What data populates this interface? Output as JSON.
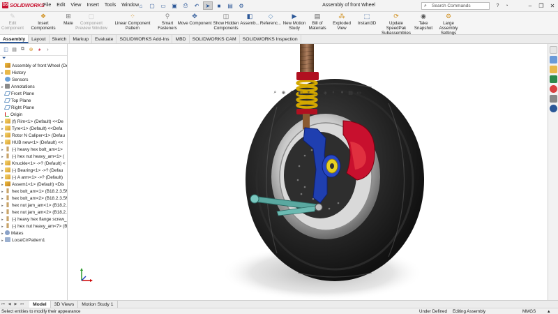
{
  "app": {
    "logo": "SOLIDWORKS",
    "doc_title": "Assembly of front Wheel"
  },
  "menu": [
    "File",
    "Edit",
    "View",
    "Insert",
    "Tools",
    "Window"
  ],
  "search": {
    "placeholder": "Search Commands"
  },
  "ribbon": [
    {
      "l1": "Edit",
      "l2": "Component",
      "state": "disabled",
      "icon": "edit-component-icon"
    },
    {
      "l1": "Insert Components",
      "l2": "",
      "state": "enabled",
      "icon": "insert-components-icon"
    },
    {
      "l1": "Mate",
      "l2": "",
      "state": "enabled",
      "icon": "mate-icon"
    },
    {
      "l1": "Component",
      "l2": "Preview Window",
      "state": "disabled",
      "icon": "preview-window-icon"
    },
    {
      "l1": "Linear Component Pattern",
      "l2": "",
      "state": "enabled",
      "icon": "pattern-icon"
    },
    {
      "l1": "Smart",
      "l2": "Fasteners",
      "state": "enabled",
      "icon": "fastener-icon"
    },
    {
      "l1": "Move Component",
      "l2": "",
      "state": "enabled",
      "icon": "move-icon"
    },
    {
      "l1": "Show Hidden",
      "l2": "Components",
      "state": "enabled",
      "icon": "show-hidden-icon"
    },
    {
      "l1": "Assemb...",
      "l2": "",
      "state": "enabled",
      "icon": "assembly-features-icon"
    },
    {
      "l1": "Referenc...",
      "l2": "",
      "state": "enabled",
      "icon": "reference-geometry-icon"
    },
    {
      "l1": "New Motion",
      "l2": "Study",
      "state": "enabled",
      "icon": "motion-study-icon"
    },
    {
      "l1": "Bill of",
      "l2": "Materials",
      "state": "enabled",
      "icon": "bom-icon"
    },
    {
      "l1": "Exploded View",
      "l2": "",
      "state": "enabled",
      "icon": "exploded-view-icon"
    },
    {
      "l1": "Instant3D",
      "l2": "",
      "state": "enabled",
      "icon": "instant3d-icon"
    },
    {
      "l1": "Update SpeedPak",
      "l2": "Subassemblies",
      "state": "enabled",
      "icon": "speedpak-icon"
    },
    {
      "l1": "Take",
      "l2": "Snapshot",
      "state": "enabled",
      "icon": "snapshot-icon"
    },
    {
      "l1": "Large Assembly",
      "l2": "Settings",
      "state": "enabled",
      "icon": "large-assembly-icon"
    }
  ],
  "tabs": [
    "Assembly",
    "Layout",
    "Sketch",
    "Markup",
    "Evaluate",
    "SOLIDWORKS Add-Ins",
    "MBD",
    "SOLIDWORKS CAM",
    "SOLIDWORKS Inspection"
  ],
  "tree": [
    {
      "label": "Assembly of front Wheel (Defa",
      "icon": "asm",
      "arrow": ""
    },
    {
      "label": "History",
      "icon": "folder",
      "arrow": "▸"
    },
    {
      "label": "Sensors",
      "icon": "sensor",
      "arrow": ""
    },
    {
      "label": "Annotations",
      "icon": "annot",
      "arrow": "▸"
    },
    {
      "label": "Front Plane",
      "icon": "plane",
      "arrow": ""
    },
    {
      "label": "Top Plane",
      "icon": "plane",
      "arrow": ""
    },
    {
      "label": "Right Plane",
      "icon": "plane",
      "arrow": ""
    },
    {
      "label": "Origin",
      "icon": "origin",
      "arrow": ""
    },
    {
      "label": "(f) Rim<1> (Default) <<De",
      "icon": "part",
      "arrow": "▸"
    },
    {
      "label": "Tyre<1> (Default) <<Defa",
      "icon": "part",
      "arrow": "▸"
    },
    {
      "label": "Rotor N Caliper<1> (Defau",
      "icon": "part",
      "arrow": "▸"
    },
    {
      "label": "HUB new<1> (Default) <<",
      "icon": "part",
      "arrow": "▸"
    },
    {
      "label": "(-) heavy hex bolt_am<1>",
      "icon": "bolt",
      "arrow": "▸"
    },
    {
      "label": "(-) hex nut heavy_am<1> (",
      "icon": "bolt",
      "arrow": "▸"
    },
    {
      "label": "Knuckle<1> ->? (Default) <",
      "icon": "part",
      "arrow": "▸"
    },
    {
      "label": "(-) Bearing<1> ->? (Defau",
      "icon": "part",
      "arrow": "▸"
    },
    {
      "label": "(-) A arm<1> ->? (Default)",
      "icon": "part",
      "arrow": "▸"
    },
    {
      "label": "Assem1<1> (Default) <Dis",
      "icon": "asm",
      "arrow": "▸"
    },
    {
      "label": "hex bolt_am<1> (B18.2.3.5M",
      "icon": "bolt",
      "arrow": "▸"
    },
    {
      "label": "hex bolt_am<2> (B18.2.3.5M",
      "icon": "bolt",
      "arrow": "▸"
    },
    {
      "label": "hex nut jam_am<1> (B18.2.",
      "icon": "bolt",
      "arrow": "▸"
    },
    {
      "label": "hex nut jam_am<2> (B18.2.",
      "icon": "bolt",
      "arrow": "▸"
    },
    {
      "label": "(-) heavy hex flange screw_",
      "icon": "bolt",
      "arrow": "▸"
    },
    {
      "label": "(-) hex nut heavy_am<7> (B",
      "icon": "bolt",
      "arrow": "▸"
    },
    {
      "label": "Mates",
      "icon": "mates",
      "arrow": "▸"
    },
    {
      "label": "LocalCirPattern1",
      "icon": "pattern",
      "arrow": "▸"
    }
  ],
  "model_tabs": [
    "Model",
    "3D Views",
    "Motion Study 1"
  ],
  "status": {
    "message": "Select entities to modify their appearance",
    "state": "Under Defined",
    "mode": "Editing Assembly",
    "units": "MMGS",
    "units_arrow": "▴"
  },
  "colors": {
    "accent": "#2b5797",
    "caliper": "#c8102e",
    "spring": "#e8c020",
    "knuckle": "#1f3fb0",
    "arm": "#5aa8a0"
  }
}
